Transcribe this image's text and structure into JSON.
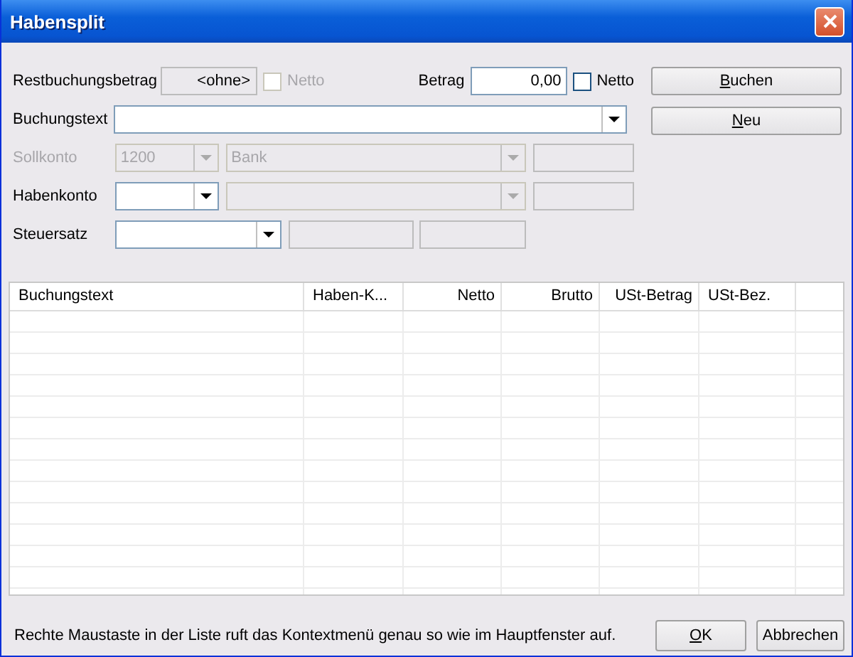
{
  "window": {
    "title": "Habensplit"
  },
  "rest": {
    "label": "Restbuchungsbetrag",
    "value": "<ohne>",
    "checkbox": {
      "label": "Netto",
      "checked": false,
      "disabled": true
    }
  },
  "betrag": {
    "label": "Betrag",
    "value": "0,00",
    "checkbox": {
      "label": "Netto",
      "checked": false,
      "disabled": false
    }
  },
  "side_buttons": [
    {
      "label": "Buchen"
    },
    {
      "label": "Neu"
    }
  ],
  "buchungstext": {
    "label": "Buchungstext"
  },
  "konten": [
    {
      "label": "Sollkonto",
      "disabled": true,
      "number": "1200",
      "name": "Bank"
    },
    {
      "label": "Habenkonto",
      "disabled": false
    }
  ],
  "steuersatz": {
    "label": "Steuersatz"
  },
  "table": {
    "columns": [
      {
        "label": "Buchungstext",
        "kind": "text"
      },
      {
        "label": "Haben-K...",
        "kind": "text"
      },
      {
        "label": "Netto",
        "kind": "number"
      },
      {
        "label": "Brutto",
        "kind": "number"
      },
      {
        "label": "USt-Betrag",
        "kind": "number"
      },
      {
        "label": "USt-Bez.",
        "kind": "text"
      }
    ]
  },
  "hint": "Rechte Maustaste in der Liste ruft das Kontextmenü genau so wie im Hauptfenster auf.",
  "footer_buttons": [
    {
      "label": "OK"
    },
    {
      "label": "Abbrechen",
      "mnemonic": false
    }
  ]
}
